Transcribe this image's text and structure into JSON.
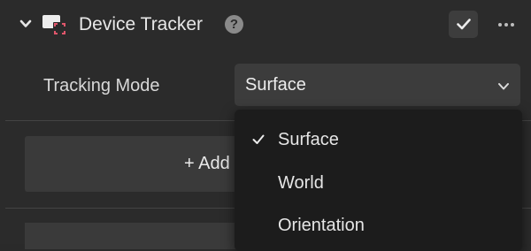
{
  "component": {
    "title": "Device Tracker",
    "help_symbol": "?",
    "icon": "device-tracker-icon",
    "collapse_icon": "chevron-down-icon",
    "enabled": true,
    "menu_icon": "more-horizontal-icon"
  },
  "tracking_mode": {
    "label": "Tracking Mode",
    "selected": "Surface",
    "options": [
      {
        "label": "Surface",
        "selected": true
      },
      {
        "label": "World",
        "selected": false
      },
      {
        "label": "Orientation",
        "selected": false
      }
    ]
  },
  "add_button": {
    "label": "+ Add"
  },
  "colors": {
    "panel_bg": "#2b2b2b",
    "select_bg": "#3c3c3c",
    "dropdown_bg": "#1c1c1c",
    "icon_accent": "#e0566b"
  }
}
